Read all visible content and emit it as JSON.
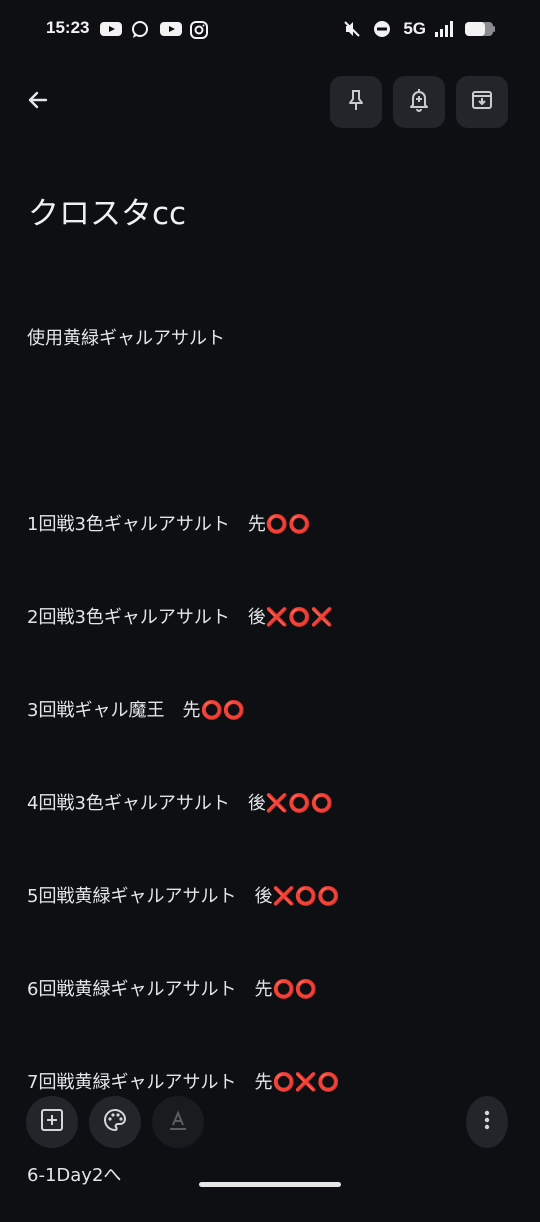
{
  "status_bar": {
    "time": "15:23",
    "left_icons": [
      "youtube-icon",
      "chat-bubble-icon",
      "youtube-icon",
      "instagram-icon"
    ],
    "right_icons": [
      "mute-icon",
      "dnd-icon",
      "signal-icon",
      "battery-icon"
    ],
    "network": "5G"
  },
  "toolbar": {
    "back_icon": "arrow-left-icon",
    "pin_icon": "pin-icon",
    "remind_icon": "bell-plus-icon",
    "archive_icon": "archive-icon"
  },
  "note": {
    "title": "クロスタcc",
    "lines": [
      "使用黄緑ギャルアサルト",
      "",
      "1回戦3色ギャルアサルト　先⭕⭕",
      "2回戦3色ギャルアサルト　後❌⭕❌",
      "3回戦ギャル魔王　先⭕⭕",
      "4回戦3色ギャルアサルト　後❌⭕⭕",
      "5回戦黄緑ギャルアサルト　後❌⭕⭕",
      "6回戦黄緑ギャルアサルト　先⭕⭕",
      "7回戦黄緑ギャルアサルト　先⭕❌⭕",
      "6-1Day2へ"
    ]
  },
  "bottom_bar": {
    "add_icon": "add-box-icon",
    "palette_icon": "palette-icon",
    "format_icon": "text-format-icon",
    "more_icon": "more-vert-icon"
  },
  "colors": {
    "background": "#0e0f12",
    "button_bg": "#22252a",
    "text": "#e6e7ea",
    "circle_red": "#e0243a",
    "cross_red": "#e0243a"
  }
}
